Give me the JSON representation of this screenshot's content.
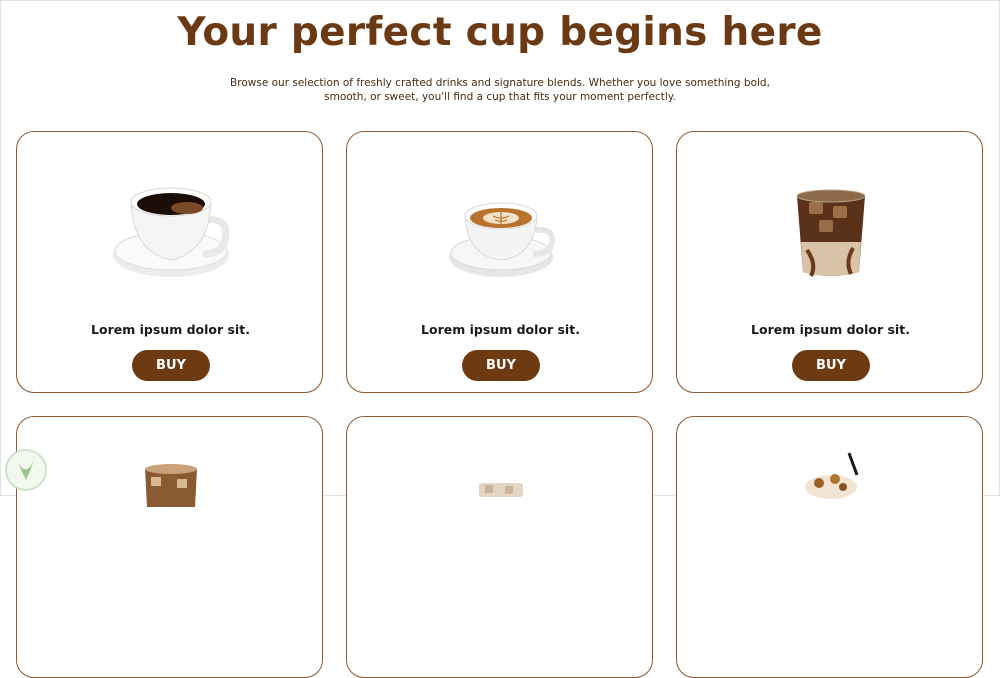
{
  "hero": {
    "title": "Your perfect cup begins here",
    "subtitle": "Browse our selection of freshly crafted drinks and signature blends. Whether you love something bold, smooth, or sweet, you'll find a cup that fits your moment perfectly."
  },
  "colors": {
    "brand_brown": "#6e3a12",
    "title_brown": "#6b3a14",
    "card_border": "#8a5a33"
  },
  "products": [
    {
      "name": "Lorem ipsum dolor sit.",
      "button": "BUY",
      "image": "black-coffee-cup-icon"
    },
    {
      "name": "Lorem ipsum dolor sit.",
      "button": "BUY",
      "image": "latte-art-cup-icon"
    },
    {
      "name": "Lorem ipsum dolor sit.",
      "button": "BUY",
      "image": "iced-mocha-glass-icon"
    },
    {
      "name": "",
      "button": "",
      "image": "iced-coffee-glass-icon"
    },
    {
      "name": "",
      "button": "",
      "image": "iced-drink-icon"
    },
    {
      "name": "",
      "button": "",
      "image": "caramel-frappe-icon"
    }
  ]
}
